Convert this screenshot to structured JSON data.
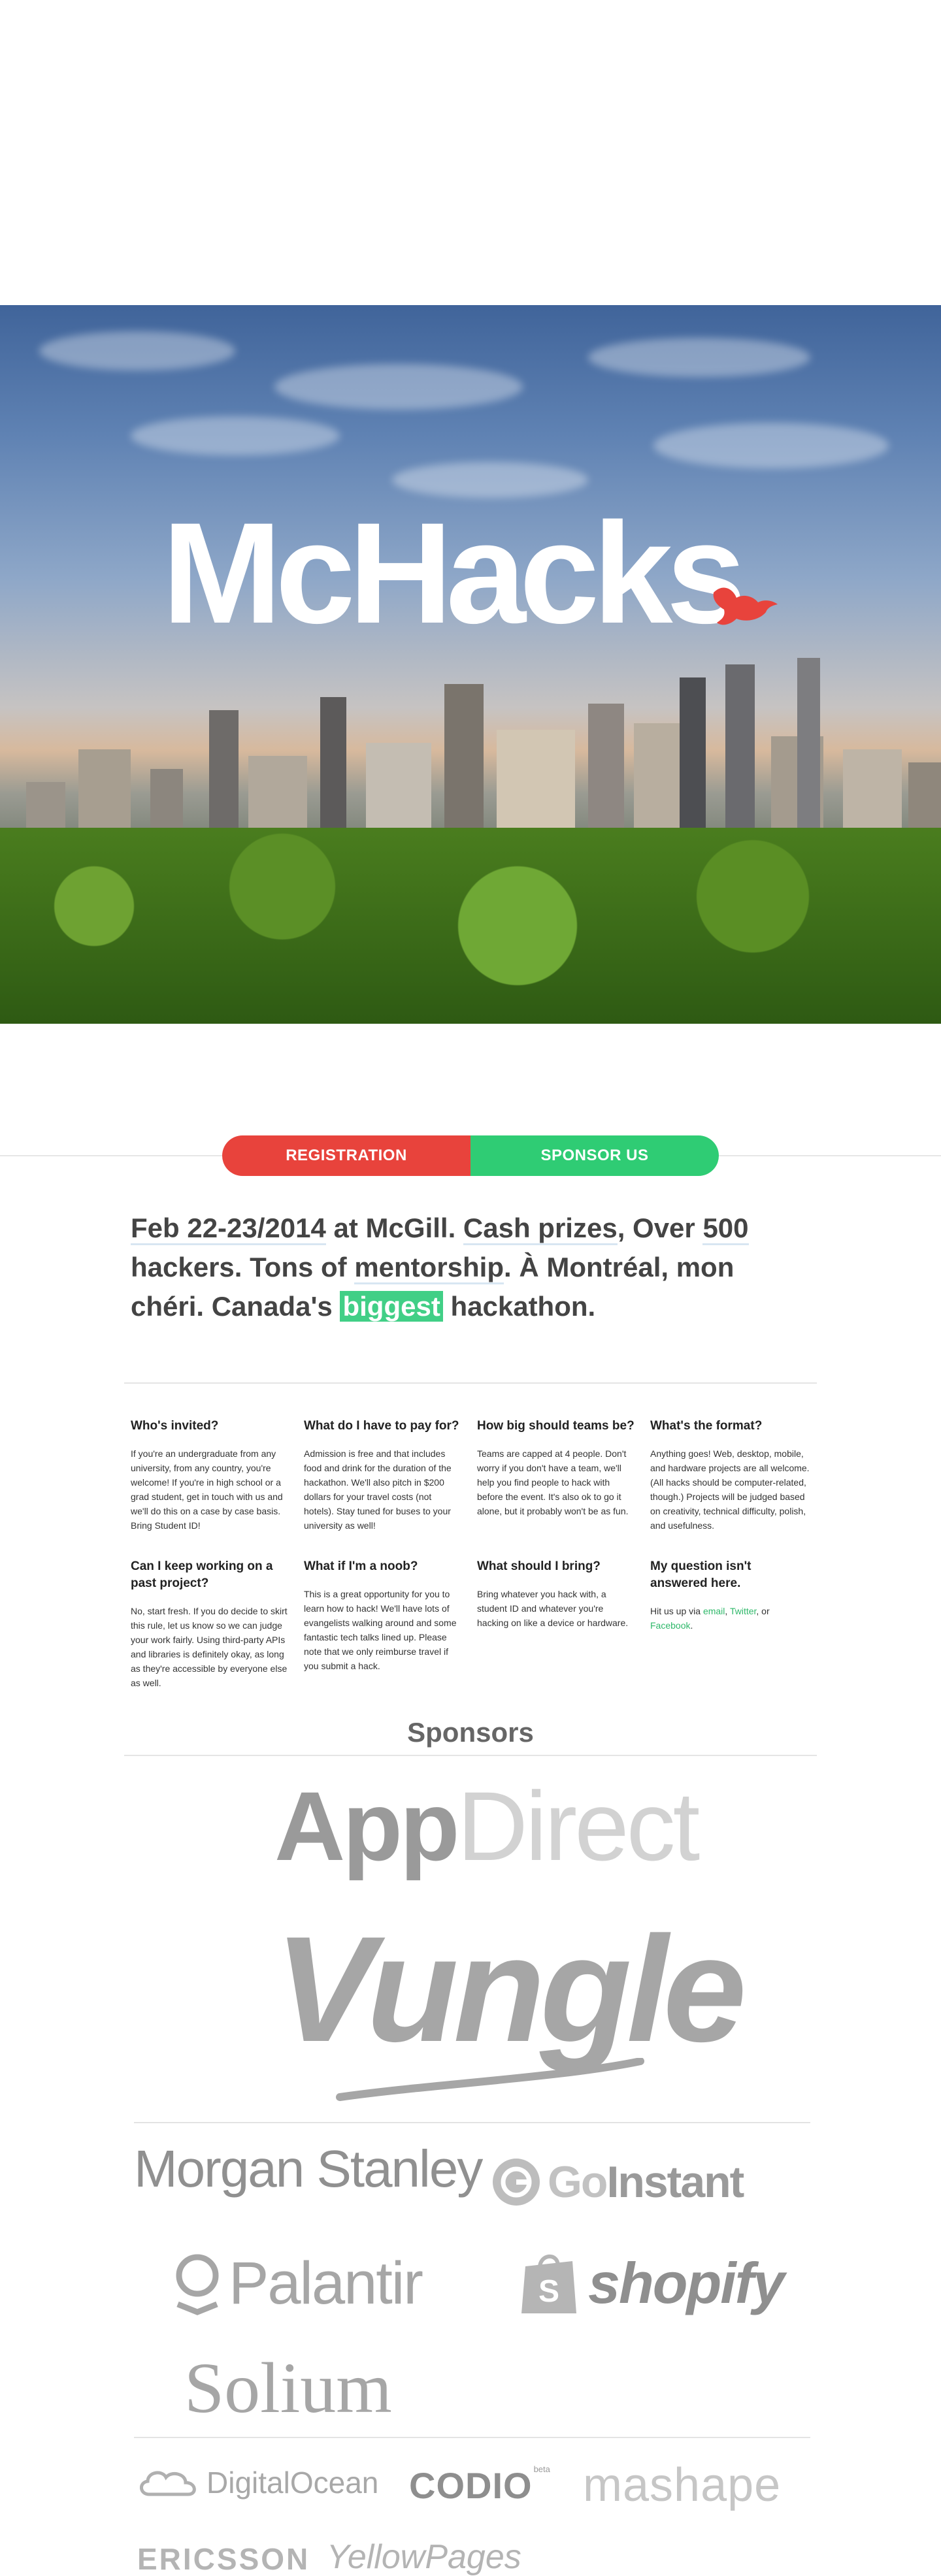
{
  "hero": {
    "logo_text": "McHacks"
  },
  "cta": {
    "registration": "REGISTRATION",
    "sponsor": "SPONSOR US"
  },
  "tagline": {
    "p1": "Feb 22-23/2014",
    "p2": " at McGill. ",
    "p3": "Cash prizes",
    "p4": ", Over ",
    "p5": "500",
    "p6": " hackers. Tons of ",
    "p7": "mentorship",
    "p8": ". À Montréal, mon chéri. Canada's ",
    "p9": "biggest",
    "p10": " hackathon."
  },
  "faq": [
    {
      "q": "Who's invited?",
      "a": "If you're an undergraduate from any university, from any country, you're welcome! If you're in high school or a grad student, get in touch with us and we'll do this on a case by case basis. Bring Student ID!"
    },
    {
      "q": "What do I have to pay for?",
      "a": "Admission is free and that includes food and drink for the duration of the hackathon. We'll also pitch in $200 dollars for your travel costs (not hotels). Stay tuned for buses to your university as well!"
    },
    {
      "q": "How big should teams be?",
      "a": "Teams are capped at 4 people. Don't worry if you don't have a team, we'll help you find people to hack with before the event. It's also ok to go it alone, but it probably won't be as fun."
    },
    {
      "q": "What's the format?",
      "a": "Anything goes! Web, desktop, mobile, and hardware projects are all welcome. (All hacks should be computer-related, though.) Projects will be judged based on creativity, technical difficulty, polish, and usefulness."
    },
    {
      "q": "Can I keep working on a past project?",
      "a": "No, start fresh. If you do decide to skirt this rule, let us know so we can judge your work fairly. Using third-party APIs and libraries is definitely okay, as long as they're accessible by everyone else as well."
    },
    {
      "q": "What if I'm a noob?",
      "a": "This is a great opportunity for you to learn how to hack! We'll have lots of evangelists walking around and some fantastic tech talks lined up. Please note that we only reimburse travel if you submit a hack."
    },
    {
      "q": "What should I bring?",
      "a": "Bring whatever you hack with, a student ID and whatever you're hacking on like a device or hardware."
    },
    {
      "q": "My question isn't answered here.",
      "a_pre": "Hit us up via ",
      "link_email": "email",
      "sep1": ", ",
      "link_twitter": "Twitter",
      "sep2": ", or ",
      "link_facebook": "Facebook",
      "a_post": "."
    }
  ],
  "sponsors": {
    "title": "Sponsors",
    "appdirect_a": "App",
    "appdirect_b": "Direct",
    "vungle": "Vungle",
    "morganstanley": "Morgan Stanley",
    "goinstant_a": "Go",
    "goinstant_b": "Instant",
    "palantir": "Palantir",
    "shopify": "shopify",
    "solium": "Solium",
    "digitalocean": "DigitalOcean",
    "codio": "CODIO",
    "codio_beta": "beta",
    "mashape": "mashape",
    "ericsson": "ERICSSON",
    "yellowpages": "YellowPages"
  },
  "colors": {
    "registration": "#e8433c",
    "sponsor": "#2fcc74",
    "highlight": "#41cf86",
    "link": "#2fb86a",
    "bird": "#e8433c"
  }
}
